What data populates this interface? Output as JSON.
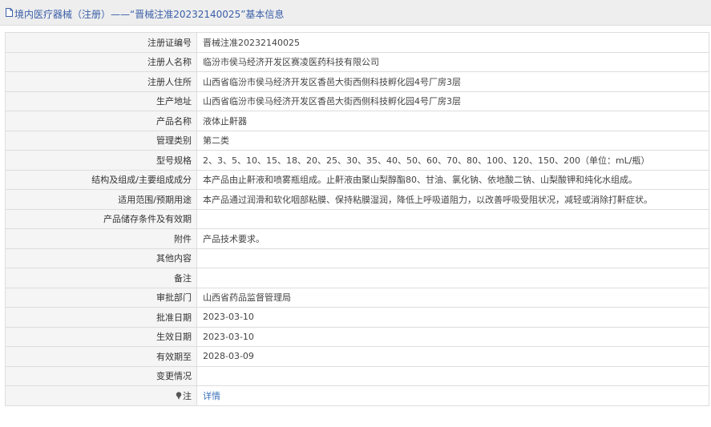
{
  "header": {
    "title": "境内医疗器械（注册）——“晋械注准20232140025”基本信息"
  },
  "rows": [
    {
      "label": "注册证编号",
      "value": "晋械注准20232140025"
    },
    {
      "label": "注册人名称",
      "value": "临汾市侯马经济开发区赛凌医药科技有限公司"
    },
    {
      "label": "注册人住所",
      "value": "山西省临汾市侯马经济开发区香邑大街西侧科技孵化园4号厂房3层"
    },
    {
      "label": "生产地址",
      "value": "山西省临汾市侯马经济开发区香邑大街西侧科技孵化园4号厂房3层"
    },
    {
      "label": "产品名称",
      "value": "液体止鼾器"
    },
    {
      "label": "管理类别",
      "value": "第二类"
    },
    {
      "label": "型号规格",
      "value": "2、3、5、10、15、18、20、25、30、35、40、50、60、70、80、100、120、150、200（单位：mL/瓶）"
    },
    {
      "label": "结构及组成/主要组成成分",
      "value": "本产品由止鼾液和喷雾瓶组成。止鼾液由聚山梨醇酯80、甘油、氯化钠、依地酸二钠、山梨酸钾和纯化水组成。"
    },
    {
      "label": "适用范围/预期用途",
      "value": "本产品通过润滑和软化咽部粘膜、保持粘膜湿润，降低上呼吸道阻力，以改善呼吸受阻状况，减轻或消除打鼾症状。"
    },
    {
      "label": "产品储存条件及有效期",
      "value": ""
    },
    {
      "label": "附件",
      "value": "产品技术要求。"
    },
    {
      "label": "其他内容",
      "value": ""
    },
    {
      "label": "备注",
      "value": ""
    },
    {
      "label": "审批部门",
      "value": "山西省药品监督管理局"
    },
    {
      "label": "批准日期",
      "value": "2023-03-10"
    },
    {
      "label": "生效日期",
      "value": "2023-03-10"
    },
    {
      "label": "有效期至",
      "value": "2028-03-09"
    },
    {
      "label": "变更情况",
      "value": ""
    }
  ],
  "note_row": {
    "icon": "pin-icon",
    "label": "注",
    "link_text": "详情"
  },
  "colors": {
    "title_text": "#3a5fa8",
    "link": "#3a6fb8",
    "label_bg": "#f5f5f5",
    "border": "#dddddd"
  }
}
